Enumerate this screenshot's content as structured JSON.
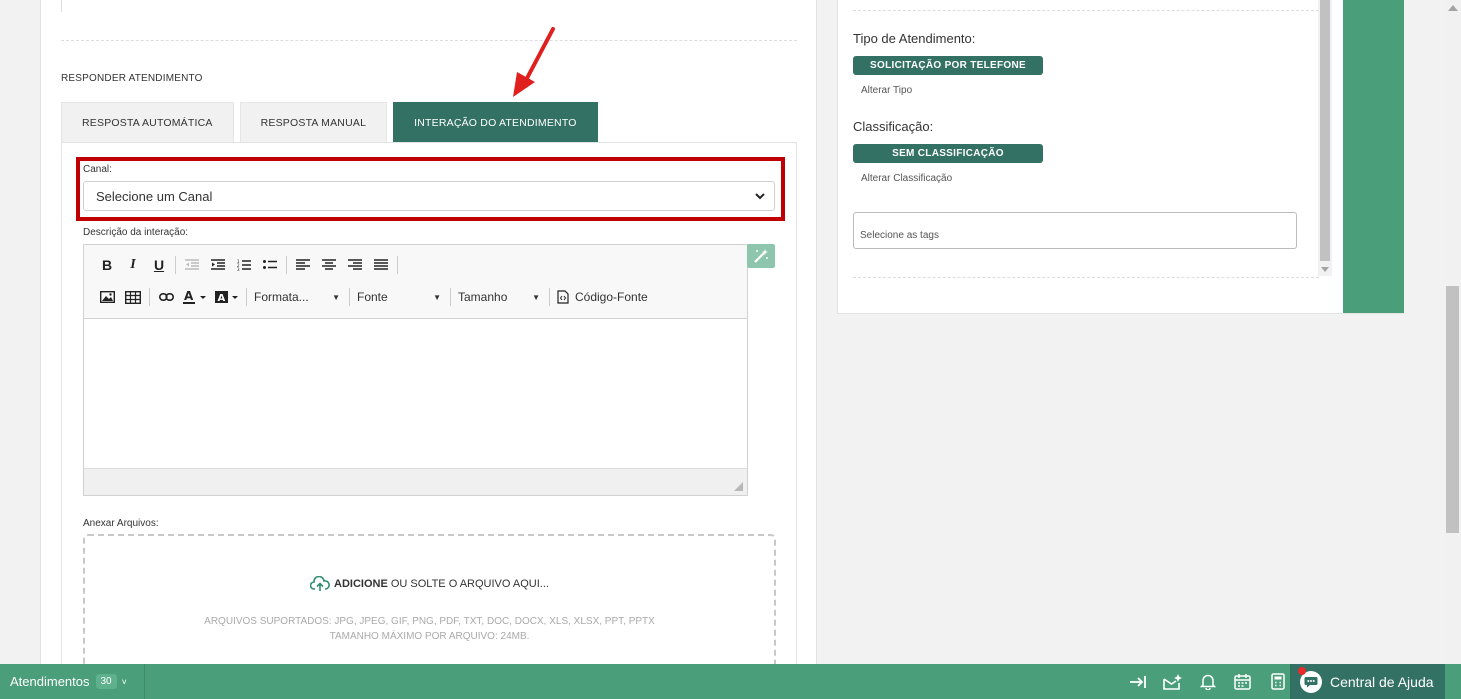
{
  "main": {
    "section_title": "RESPONDER ATENDIMENTO",
    "tabs": [
      {
        "label": "RESPOSTA AUTOMÁTICA",
        "active": false
      },
      {
        "label": "RESPOSTA MANUAL",
        "active": false
      },
      {
        "label": "INTERAÇÃO DO ATENDIMENTO",
        "active": true
      }
    ],
    "canal": {
      "label": "Canal:",
      "selected": "Selecione um Canal"
    },
    "description_label": "Descrição da interação:",
    "editor": {
      "format_label": "Formata...",
      "font_label": "Fonte",
      "size_label": "Tamanho",
      "source_label": "Código-Fonte"
    },
    "attach": {
      "label": "Anexar Arquivos:",
      "add_bold": "ADICIONE",
      "add_rest": "OU SOLTE O ARQUIVO AQUI...",
      "supported": "ARQUIVOS SUPORTADOS: JPG, JPEG, GIF, PNG, PDF, TXT, DOC, DOCX, XLS, XLSX, PPT, PPTX",
      "max_size": "TAMANHO MÁXIMO POR ARQUIVO: 24MB."
    }
  },
  "side": {
    "tipo_label": "Tipo de Atendimento:",
    "tipo_value": "SOLICITAÇÃO POR TELEFONE",
    "tipo_link": "Alterar Tipo",
    "class_label": "Classificação:",
    "class_value": "SEM CLASSIFICAÇÃO",
    "class_link": "Alterar Classificação",
    "tags_placeholder": "Selecione as tags"
  },
  "bottom_bar": {
    "atendimentos_label": "Atendimentos",
    "atendimentos_count": "30",
    "help_label": "Central de Ajuda"
  },
  "colors": {
    "accent": "#337164",
    "bar_green": "#4a9e7a",
    "highlight_red": "#c00000",
    "arrow_red": "#e01f1f"
  }
}
